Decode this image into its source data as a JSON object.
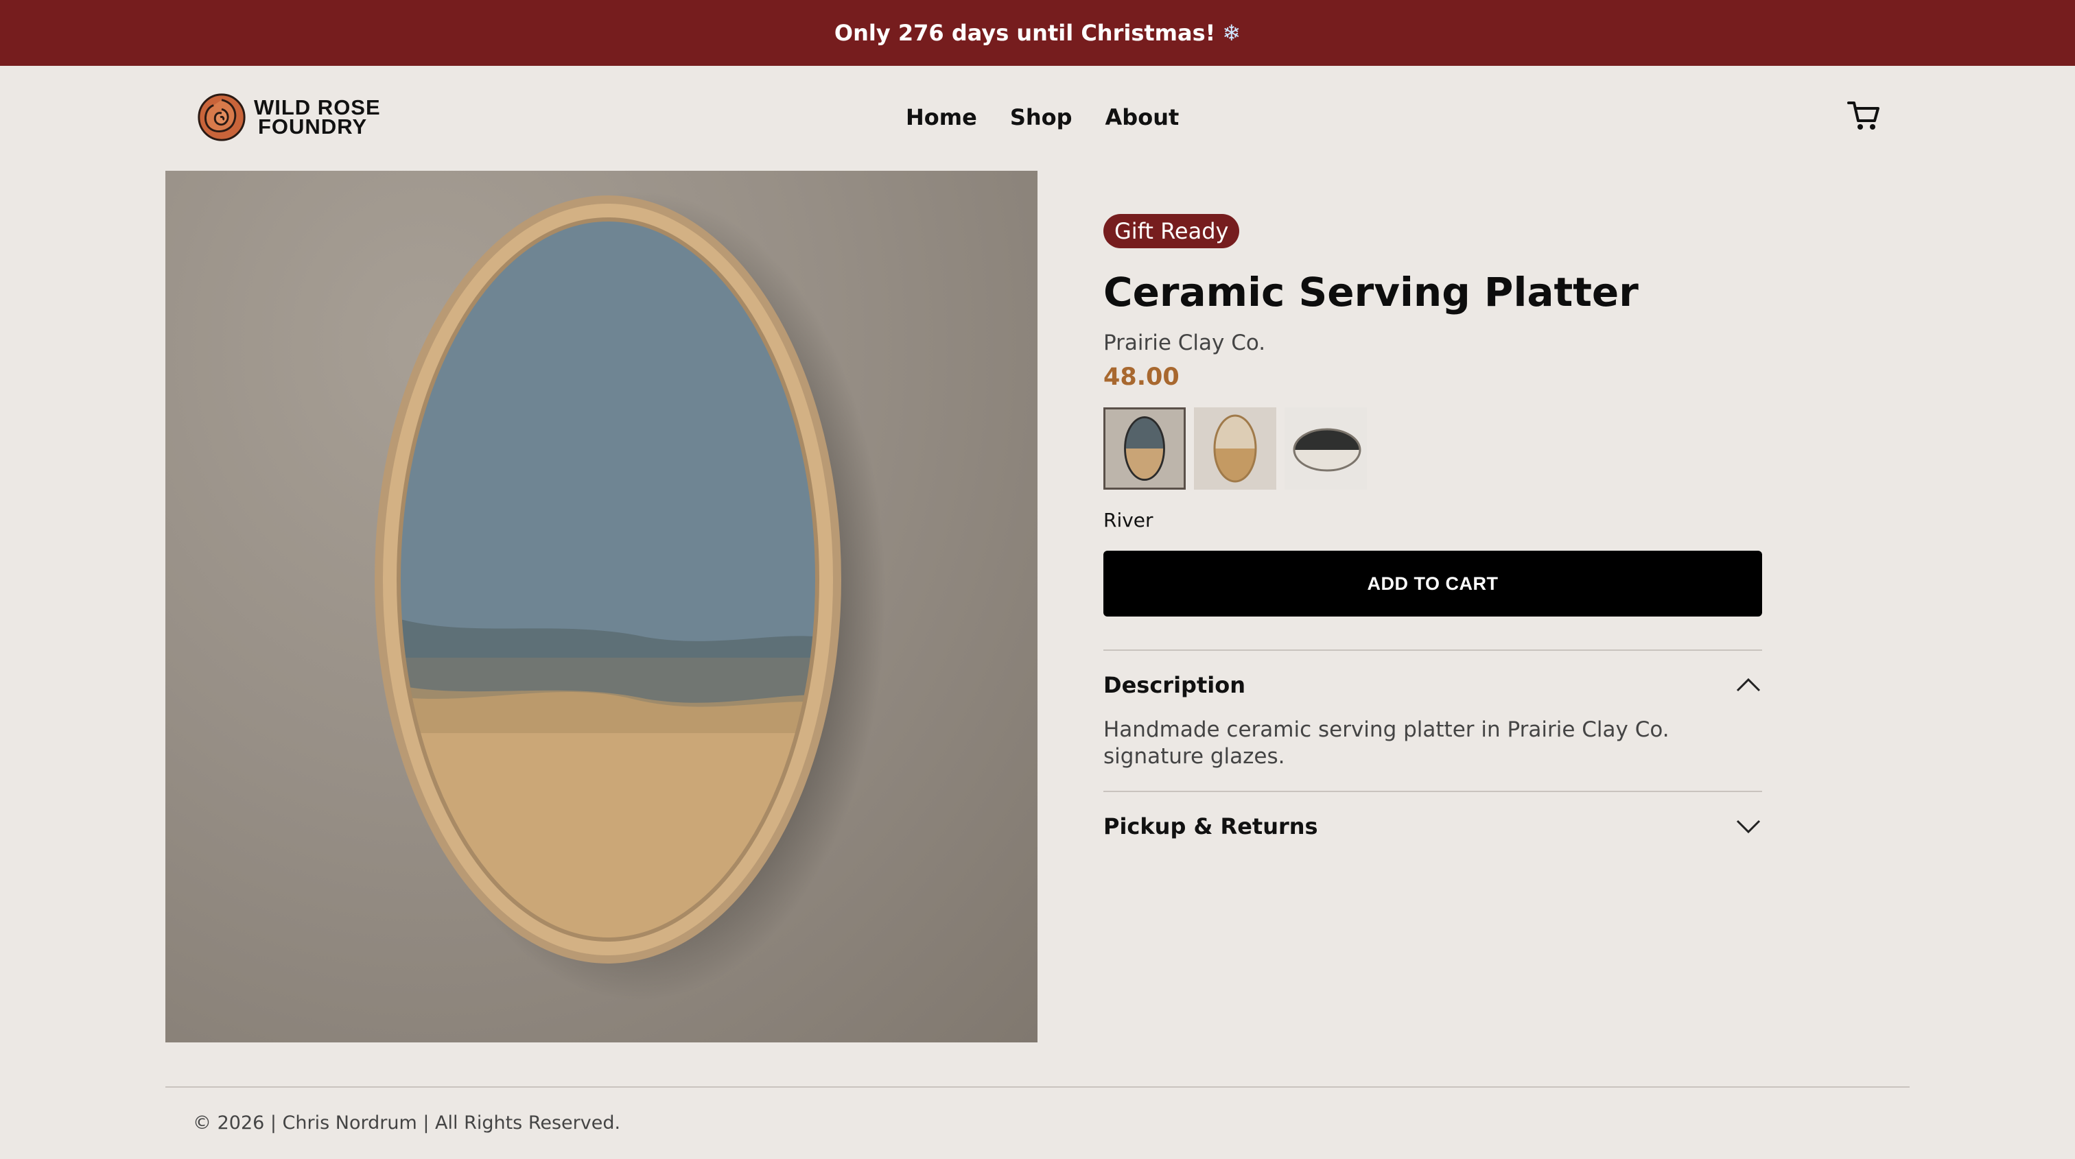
{
  "announcement": {
    "text": "Only 276 days until Christmas!",
    "emoji": "❄"
  },
  "brand": {
    "line1": "WILD ROSE",
    "line2": "FOUNDRY",
    "logo_icon": "rose-icon"
  },
  "nav": {
    "items": [
      "Home",
      "Shop",
      "About"
    ]
  },
  "cart": {
    "icon": "cart-icon"
  },
  "product": {
    "badge": "Gift Ready",
    "title": "Ceramic Serving Platter",
    "vendor": "Prairie Clay Co.",
    "price": "48.00",
    "selected_variant": "River",
    "add_to_cart": "ADD TO CART",
    "description_title": "Description",
    "description_text": "Handmade ceramic serving platter in Prairie Clay Co. signature glazes.",
    "pickup_title": "Pickup & Returns"
  },
  "colors": {
    "banner": "#761d1e",
    "price": "#a8682f",
    "button": "#000000",
    "glaze_blue": "#6f8593",
    "glaze_sand": "#cba777"
  },
  "footer": {
    "text": "© 2026 | Chris Nordrum | All Rights Reserved."
  }
}
